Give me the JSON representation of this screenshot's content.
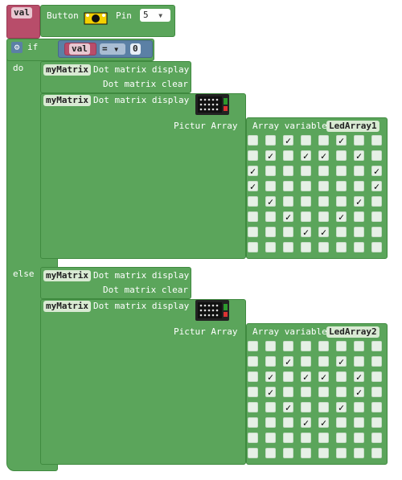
{
  "var_block": {
    "name": "val"
  },
  "button_block": {
    "label": "Button",
    "pin_label": "Pin",
    "pin_value": "5",
    "dropdown_arrow": "▼"
  },
  "if_block": {
    "if_label": "if",
    "do_label": "do",
    "else_label": "else"
  },
  "condition": {
    "var": "val",
    "operator": "=",
    "operator_arrow": "▼",
    "value": "0"
  },
  "do_branch": {
    "display1": {
      "obj": "myMatrix",
      "label": "Dot matrix display",
      "clear_label": "Dot matrix clear"
    },
    "display2": {
      "obj": "myMatrix",
      "label": "Dot matrix display",
      "pictur_label": "Pictur Array",
      "array_label": "Array variable",
      "array_name": "LedArray1"
    },
    "grid": [
      [
        0,
        0,
        1,
        0,
        0,
        1,
        0,
        0
      ],
      [
        0,
        1,
        0,
        1,
        1,
        0,
        1,
        0
      ],
      [
        1,
        0,
        0,
        0,
        0,
        0,
        0,
        1
      ],
      [
        1,
        0,
        0,
        0,
        0,
        0,
        0,
        1
      ],
      [
        0,
        1,
        0,
        0,
        0,
        0,
        1,
        0
      ],
      [
        0,
        0,
        1,
        0,
        0,
        1,
        0,
        0
      ],
      [
        0,
        0,
        0,
        1,
        1,
        0,
        0,
        0
      ],
      [
        0,
        0,
        0,
        0,
        0,
        0,
        0,
        0
      ]
    ]
  },
  "else_branch": {
    "display1": {
      "obj": "myMatrix",
      "label": "Dot matrix display",
      "clear_label": "Dot matrix clear"
    },
    "display2": {
      "obj": "myMatrix",
      "label": "Dot matrix display",
      "pictur_label": "Pictur Array",
      "array_label": "Array variable",
      "array_name": "LedArray2"
    },
    "grid": [
      [
        0,
        0,
        0,
        0,
        0,
        0,
        0,
        0
      ],
      [
        0,
        0,
        1,
        0,
        0,
        1,
        0,
        0
      ],
      [
        0,
        1,
        0,
        1,
        1,
        0,
        1,
        0
      ],
      [
        0,
        1,
        0,
        0,
        0,
        0,
        1,
        0
      ],
      [
        0,
        0,
        1,
        0,
        0,
        1,
        0,
        0
      ],
      [
        0,
        0,
        0,
        1,
        1,
        0,
        0,
        0
      ],
      [
        0,
        0,
        0,
        0,
        0,
        0,
        0,
        0
      ],
      [
        0,
        0,
        0,
        0,
        0,
        0,
        0,
        0
      ]
    ]
  },
  "check_glyph": "✓",
  "colors": {
    "block_green": "#5ba55b",
    "var_pink": "#b84d6a",
    "logic_blue": "#5b80a5"
  }
}
